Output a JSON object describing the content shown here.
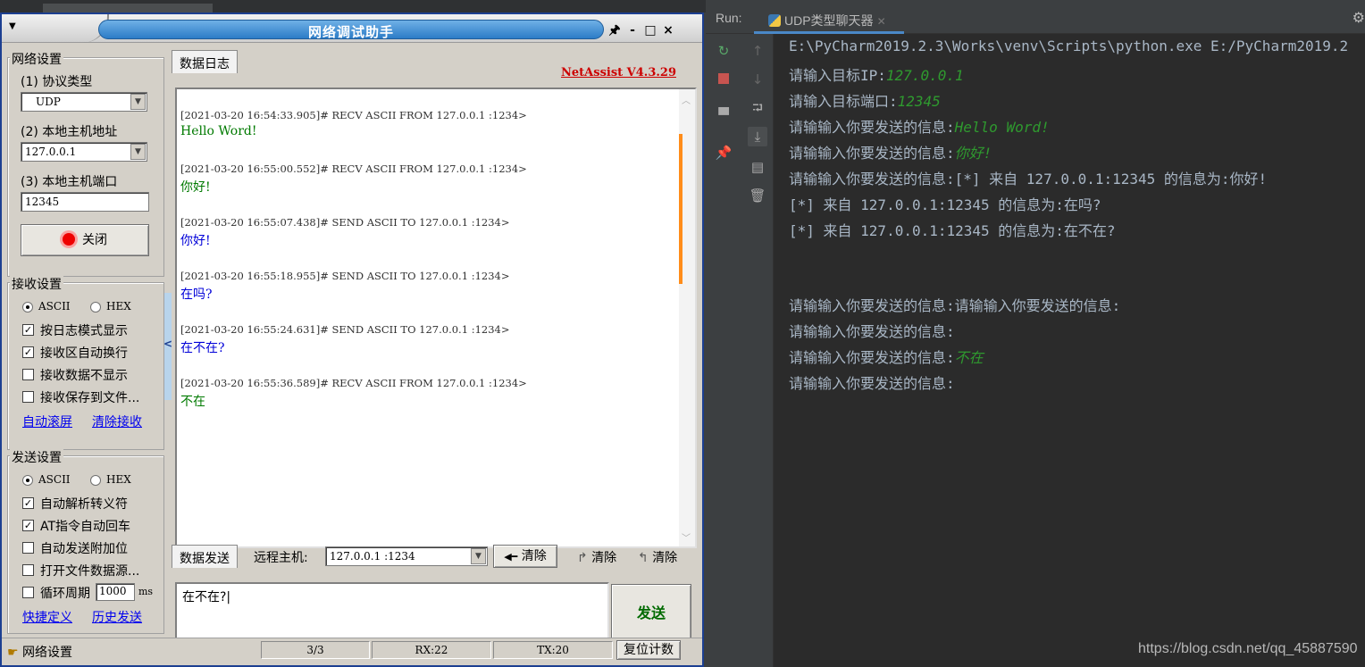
{
  "netassist": {
    "title": "网络调试助手",
    "title_controls": [
      "🖈",
      "-",
      "□",
      "×"
    ],
    "net_settings": {
      "legend": "网络设置",
      "protocol_label": "(1) 协议类型",
      "protocol_value": "UDP",
      "host_label": "(2) 本地主机地址",
      "host_value": "127.0.0.1",
      "port_label": "(3) 本地主机端口",
      "port_value": "12345",
      "close_button": "关闭"
    },
    "recv_settings": {
      "legend": "接收设置",
      "ascii": "ASCII",
      "hex": "HEX",
      "opt1": "按日志模式显示",
      "opt2": "接收区自动换行",
      "opt3": "接收数据不显示",
      "opt4": "接收保存到文件...",
      "link1": "自动滚屏",
      "link2": "清除接收"
    },
    "send_settings": {
      "legend": "发送设置",
      "ascii": "ASCII",
      "hex": "HEX",
      "opt1": "自动解析转义符",
      "opt2": "AT指令自动回车",
      "opt3": "自动发送附加位",
      "opt4": "打开文件数据源...",
      "opt5": "循环周期",
      "period_value": "1000",
      "period_unit": "ms",
      "link1": "快捷定义",
      "link2": "历史发送"
    },
    "log_tab": "数据日志",
    "version": "NetAssist V4.3.29",
    "log_entries": [
      {
        "header": "[2021-03-20 16:54:33.905]# RECV ASCII FROM 127.0.0.1 :1234>",
        "message": "Hello Word!",
        "dir": "recv"
      },
      {
        "header": "[2021-03-20 16:55:00.552]# RECV ASCII FROM 127.0.0.1 :1234>",
        "message": "你好!",
        "dir": "recv"
      },
      {
        "header": "[2021-03-20 16:55:07.438]# SEND ASCII TO 127.0.0.1 :1234>",
        "message": "你好!",
        "dir": "send"
      },
      {
        "header": "[2021-03-20 16:55:18.955]# SEND ASCII TO 127.0.0.1 :1234>",
        "message": "在吗?",
        "dir": "send"
      },
      {
        "header": "[2021-03-20 16:55:24.631]# SEND ASCII TO 127.0.0.1 :1234>",
        "message": "在不在?",
        "dir": "send"
      },
      {
        "header": "[2021-03-20 16:55:36.589]# RECV ASCII FROM 127.0.0.1 :1234>",
        "message": "不在",
        "dir": "recv"
      }
    ],
    "send_tab": "数据发送",
    "remote_label": "远程主机:",
    "remote_value": "127.0.0.1 :1234",
    "clear1": "清除",
    "clear2": "清除",
    "clear3": "清除",
    "send_text": "在不在?|",
    "send_button": "发送",
    "status": {
      "label": "网络设置",
      "count": "3/3",
      "rx": "RX:22",
      "tx": "TX:20",
      "reset": "复位计数"
    }
  },
  "pycharm": {
    "run_label": "Run:",
    "tab_label": "UDP类型聊天器",
    "console": [
      {
        "text": "E:\\PyCharm2019.2.3\\Works\\venv\\Scripts\\python.exe E:/PyCharm2019.2",
        "input": ""
      },
      {
        "text": "请输入目标IP:",
        "input": "127.0.0.1"
      },
      {
        "text": "请输入目标端口:",
        "input": "12345"
      },
      {
        "text": "请输输入你要发送的信息:",
        "input": "Hello Word!"
      },
      {
        "text": "请输输入你要发送的信息:",
        "input": "你好!"
      },
      {
        "text": "请输输入你要发送的信息:[*] 来自 127.0.0.1:12345 的信息为:你好!",
        "input": ""
      },
      {
        "text": "[*] 来自 127.0.0.1:12345 的信息为:在吗?",
        "input": ""
      },
      {
        "text": "[*] 来自 127.0.0.1:12345 的信息为:在不在?",
        "input": ""
      },
      {
        "text": "请输输入你要发送的信息:请输输入你要发送的信息:",
        "input": ""
      },
      {
        "text": "请输输入你要发送的信息:",
        "input": ""
      },
      {
        "text": "请输输入你要发送的信息:",
        "input": "不在"
      },
      {
        "text": "请输输入你要发送的信息:",
        "input": ""
      }
    ],
    "watermark": "https://blog.csdn.net/qq_45887590"
  }
}
